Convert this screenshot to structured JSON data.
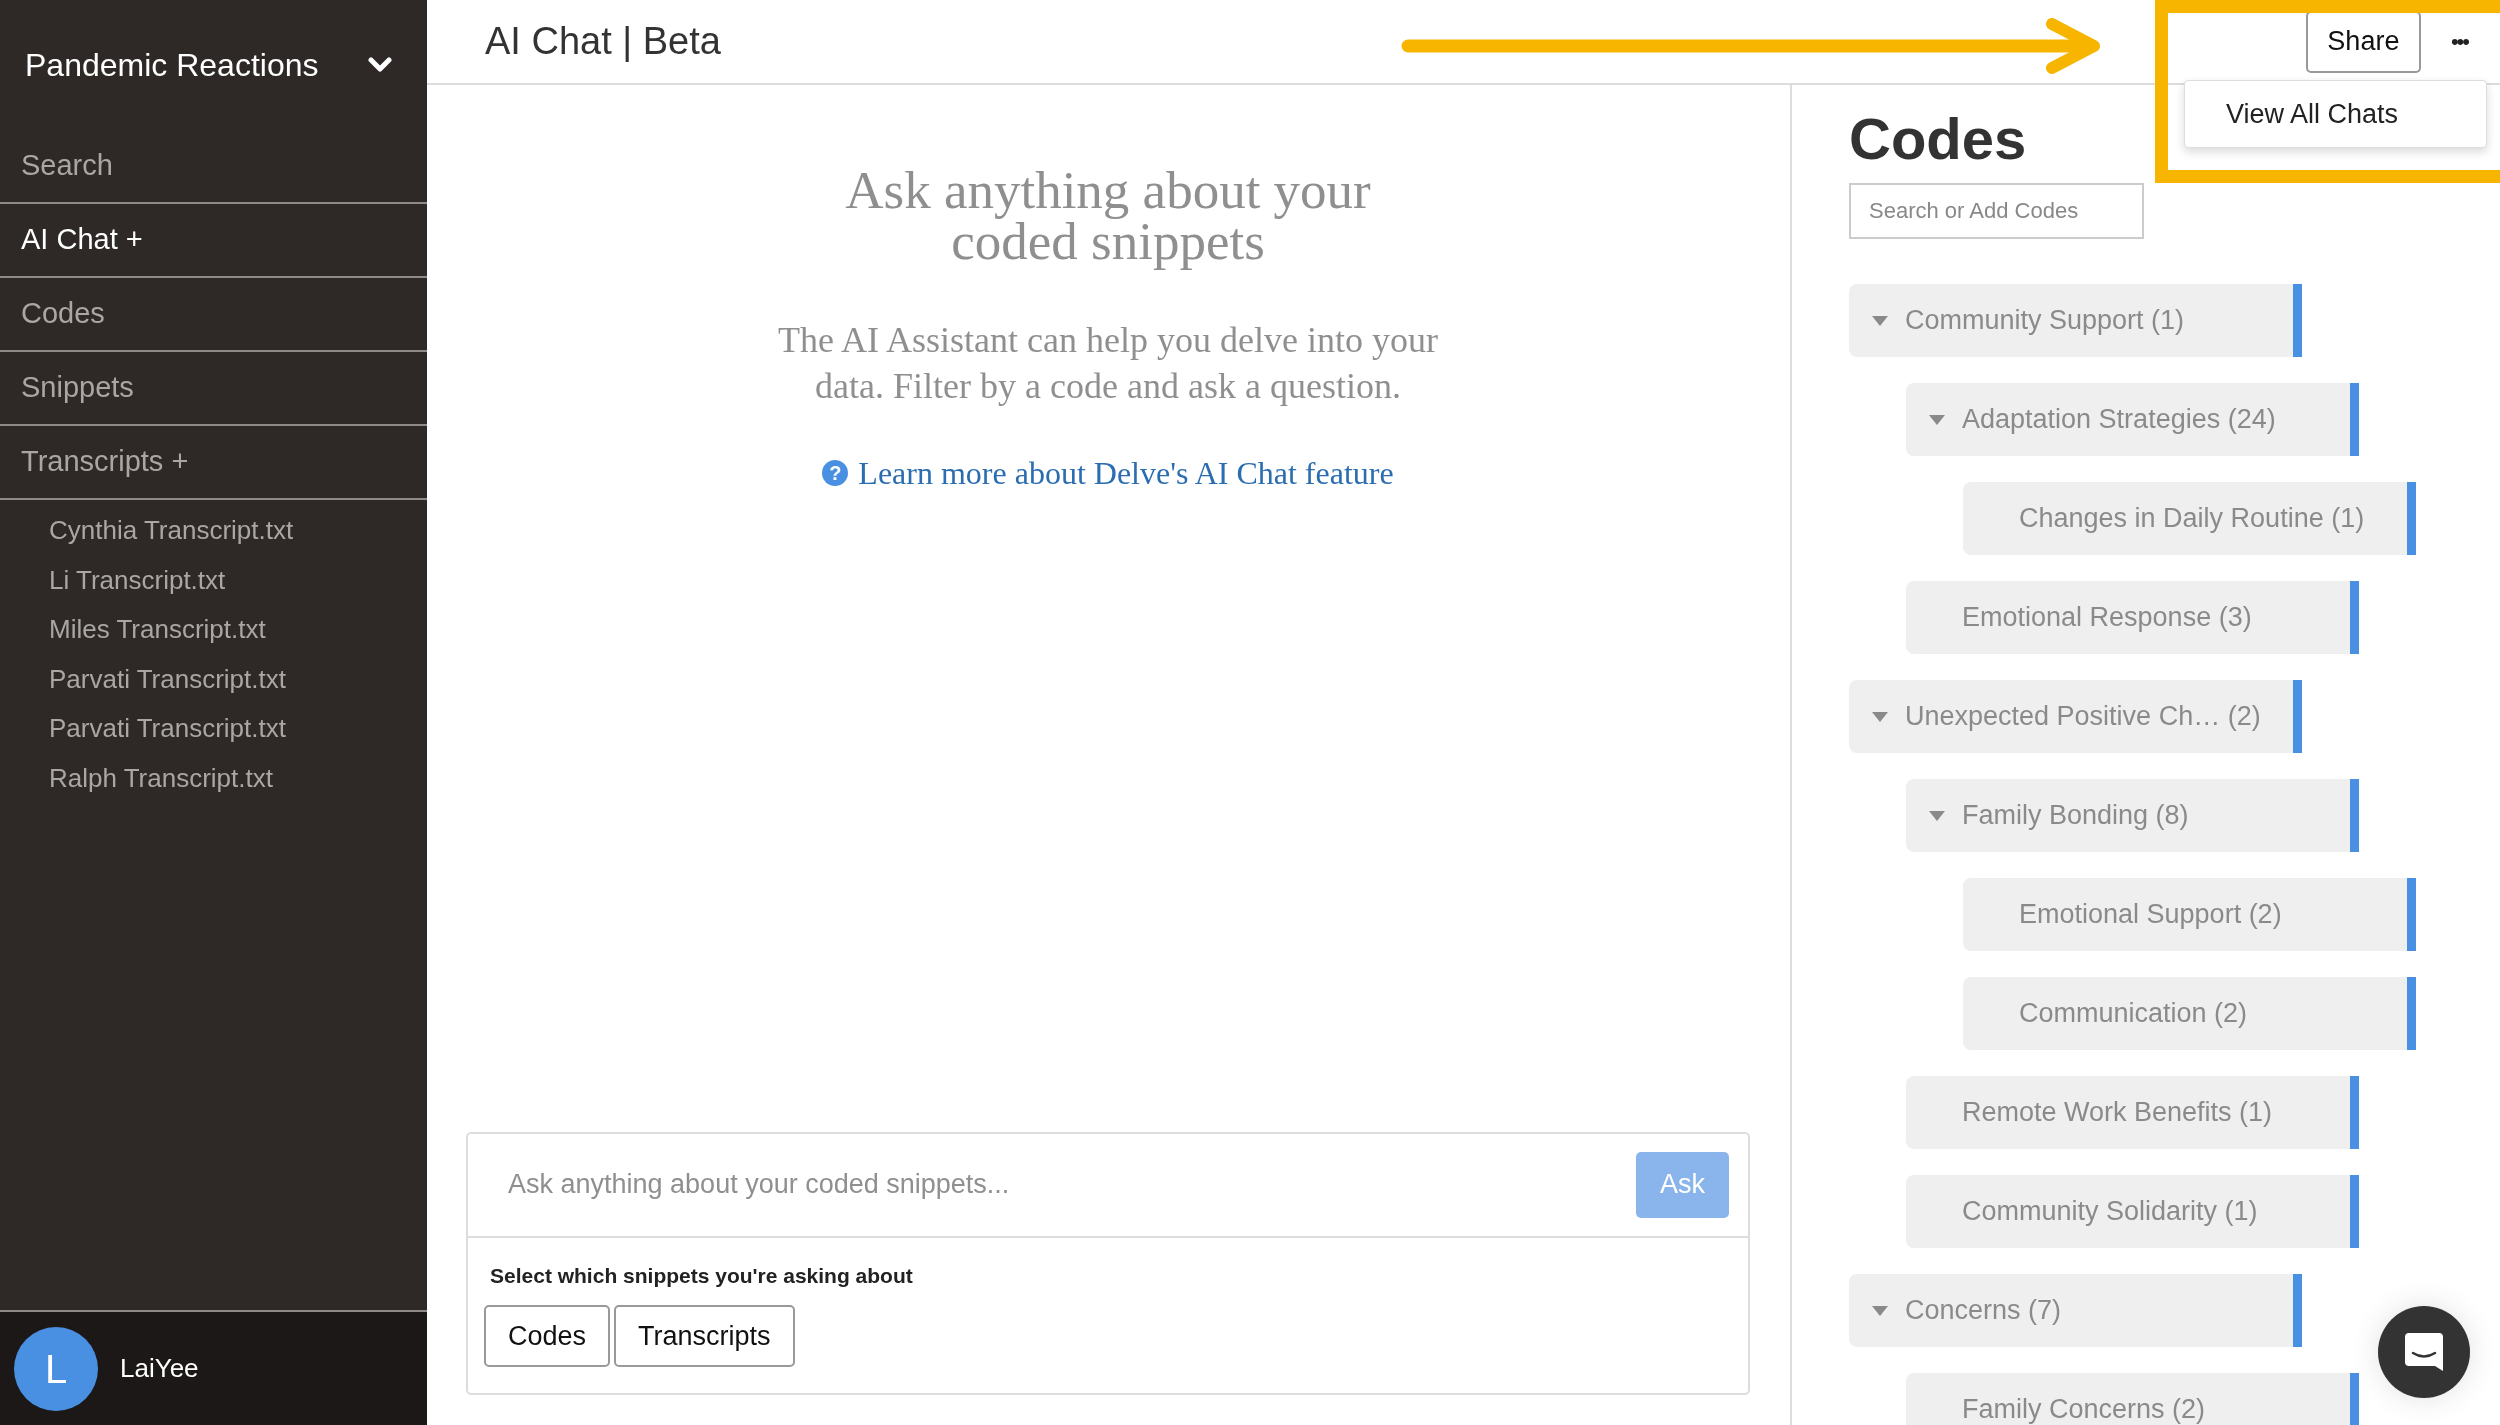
{
  "sidebar": {
    "project": "Pandemic Reactions",
    "nav": [
      {
        "label": "Search",
        "selected": false
      },
      {
        "label": "AI Chat +",
        "selected": true
      },
      {
        "label": "Codes",
        "selected": false
      },
      {
        "label": "Snippets",
        "selected": false
      },
      {
        "label": "Transcripts +",
        "selected": false
      }
    ],
    "files": [
      "Cynthia Transcript.txt",
      "Li Transcript.txt",
      "Miles Transcript.txt",
      "Parvati Transcript.txt",
      "Parvati Transcript.txt",
      "Ralph Transcript.txt"
    ],
    "user": {
      "initial": "L",
      "name": "LaiYee"
    }
  },
  "header": {
    "title": "AI Chat | Beta",
    "share": "Share",
    "more": "•••",
    "menu": {
      "open": true,
      "items": [
        "View All Chats"
      ]
    }
  },
  "intro": {
    "heading": "Ask anything about your coded snippets",
    "body": "The AI Assistant can help you delve into your data. Filter by a code and ask a question.",
    "help_glyph": "?",
    "link": "Learn more about Delve's AI Chat feature"
  },
  "composer": {
    "placeholder": "Ask anything about your coded snippets...",
    "ask": "Ask",
    "ask_disabled": true,
    "filter_label": "Select which snippets you're asking about",
    "filters": [
      "Codes",
      "Transcripts"
    ]
  },
  "codes": {
    "title": "Codes",
    "search_placeholder": "Search or Add Codes",
    "tree": [
      {
        "label": "Community Support (1)",
        "expanded": true,
        "children": [
          {
            "label": "Adaptation Strategies (24)",
            "expanded": true,
            "children": [
              {
                "label": "Changes in Daily Routine (1)"
              }
            ]
          },
          {
            "label": "Emotional Response (3)"
          }
        ]
      },
      {
        "label": "Unexpected Positive Ch… (2)",
        "expanded": true,
        "children": [
          {
            "label": "Family Bonding (8)",
            "expanded": true,
            "children": [
              {
                "label": "Emotional Support (2)"
              },
              {
                "label": "Communication (2)"
              }
            ]
          },
          {
            "label": "Remote Work Benefits (1)"
          },
          {
            "label": "Community Solidarity (1)"
          }
        ]
      },
      {
        "label": "Concerns (7)",
        "expanded": true,
        "children": [
          {
            "label": "Family Concerns (2)"
          }
        ]
      }
    ]
  }
}
